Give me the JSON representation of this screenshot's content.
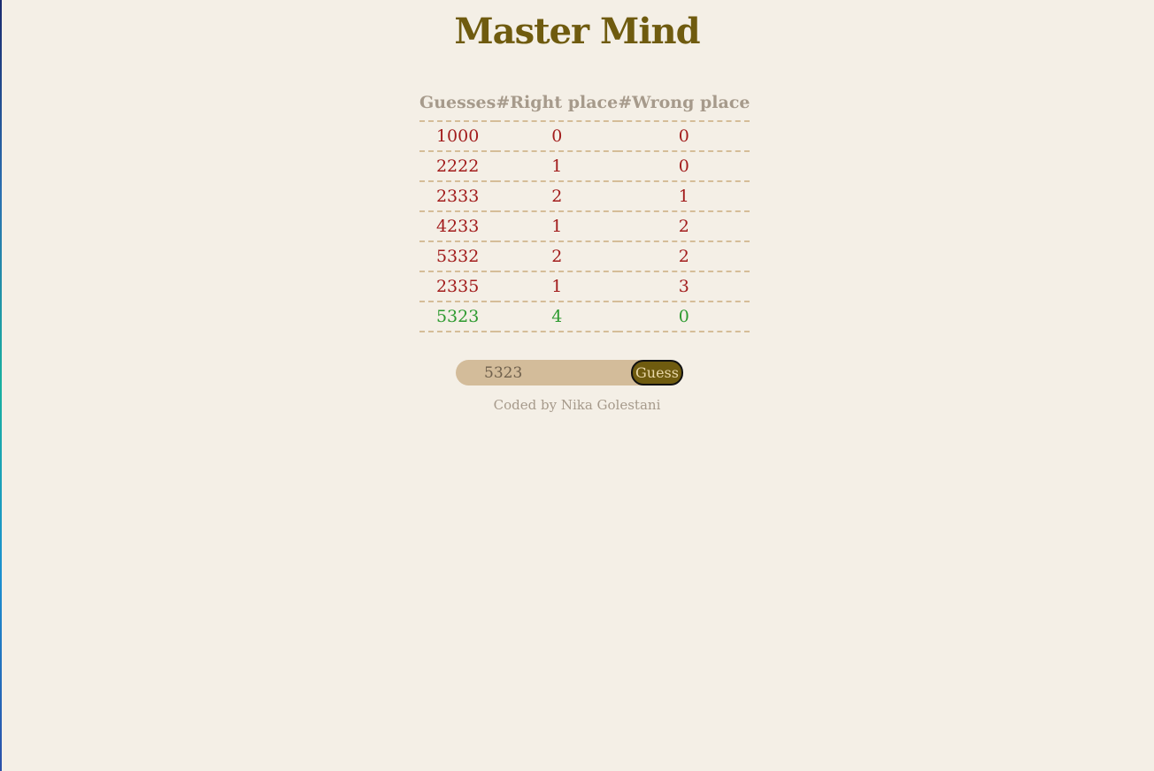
{
  "title": "Master Mind",
  "table": {
    "headers": [
      "Guesses",
      "#Right place",
      "#Wrong place"
    ],
    "rows": [
      {
        "guess": "1000",
        "right": "0",
        "wrong": "0"
      },
      {
        "guess": "2222",
        "right": "1",
        "wrong": "0"
      },
      {
        "guess": "2333",
        "right": "2",
        "wrong": "1"
      },
      {
        "guess": "4233",
        "right": "1",
        "wrong": "2"
      },
      {
        "guess": "5332",
        "right": "2",
        "wrong": "2"
      },
      {
        "guess": "2335",
        "right": "1",
        "wrong": "3"
      },
      {
        "guess": "5323",
        "right": "4",
        "wrong": "0"
      }
    ]
  },
  "form": {
    "input_value": "5323",
    "button_label": "Guess"
  },
  "credit": "Coded by Nika Golestani",
  "colors": {
    "title": "#6f5b0f",
    "row_text": "#a21c1c",
    "winning_row_text": "#2d9a2f",
    "header_text": "#a69a8b",
    "background": "#f4efe6"
  }
}
